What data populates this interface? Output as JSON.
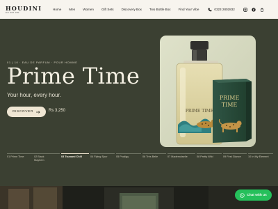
{
  "brand": {
    "name": "HOUDINI",
    "tagline": "Est 00X 000"
  },
  "nav": {
    "items": [
      "Home",
      "Men",
      "Women",
      "Gift Sets",
      "Discovery Box",
      "Two Bottle Box",
      "Find Your Vibe"
    ],
    "phone": "0323 2802832"
  },
  "hero": {
    "kicker": "01 | 10 · EAU DE PARFUM · POUR HOMME",
    "title": "Prime Time",
    "subtitle": "Your hour, every hour.",
    "cta": "DISCOVER",
    "price": "Rs 3,250",
    "box_text": "PRIME TIME"
  },
  "products": [
    {
      "label": "01 Prime Time",
      "active": false
    },
    {
      "label": "02 Black Mayhem",
      "active": false
    },
    {
      "label": "03 Tsunami Chill",
      "active": true
    },
    {
      "label": "04 Flying Spur",
      "active": false
    },
    {
      "label": "05 Prodigy",
      "active": false
    },
    {
      "label": "06 Très Belle",
      "active": false
    },
    {
      "label": "07 Mademoiselle",
      "active": false
    },
    {
      "label": "08 Pretty Wild",
      "active": false
    },
    {
      "label": "09 First Glance",
      "active": false
    },
    {
      "label": "10 In My Element",
      "active": false
    }
  ],
  "chat": {
    "label": "Chat with us"
  },
  "colors": {
    "background": "#3b4032",
    "header": "#f7f4ee",
    "box_green": "#27473a",
    "whatsapp": "#25c05b"
  }
}
